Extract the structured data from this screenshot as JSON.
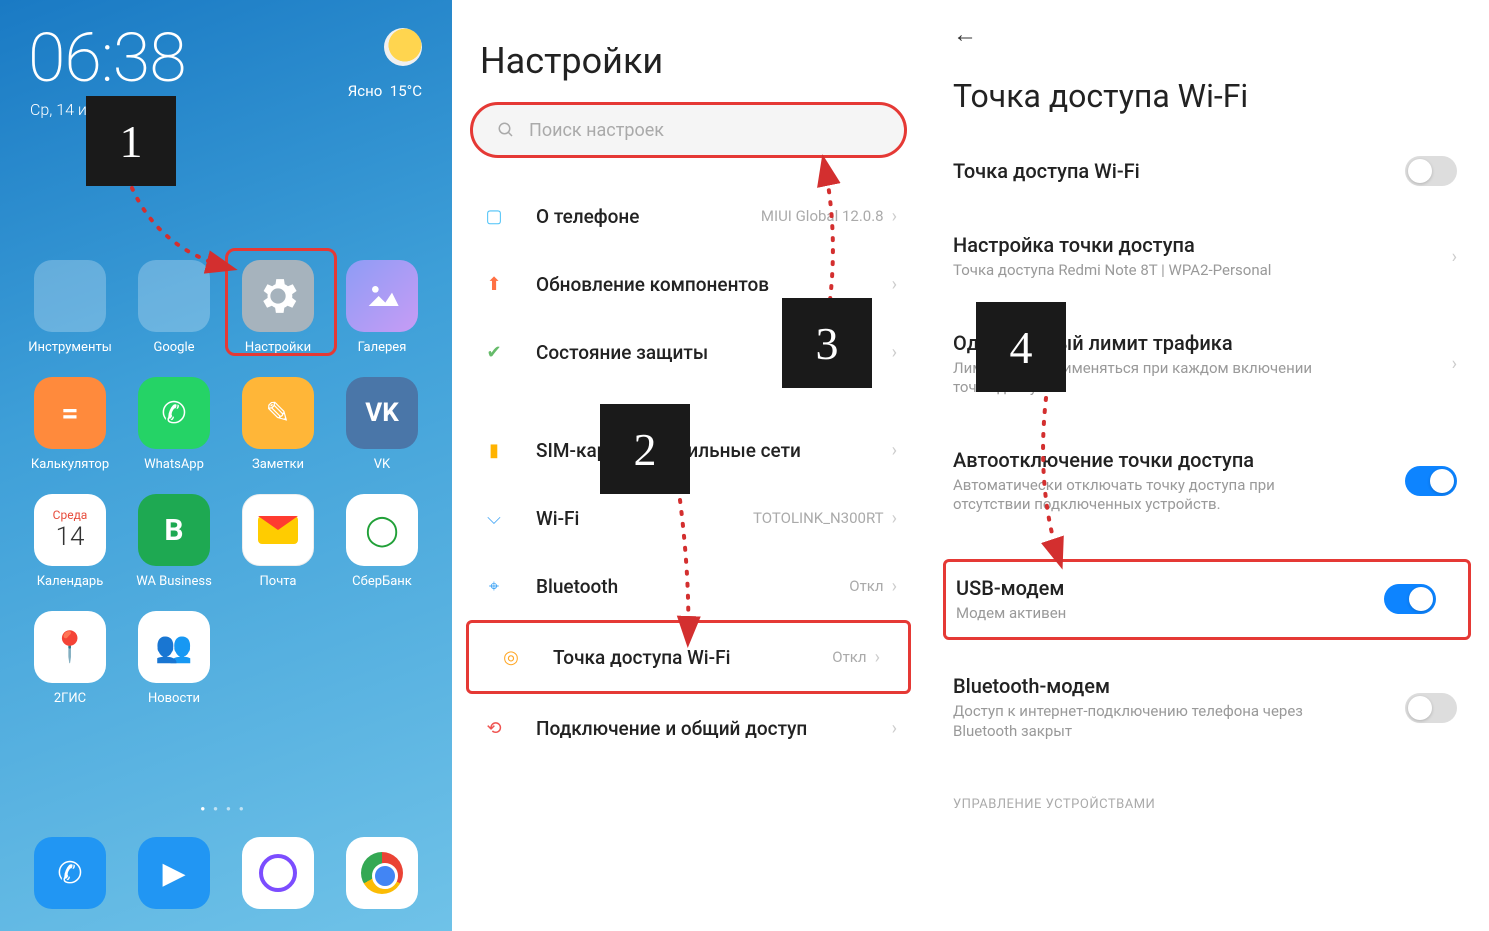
{
  "panel1": {
    "time": "06:38",
    "date": "Ср, 14 июля",
    "weather_cond": "Ясно",
    "weather_temp": "15°C",
    "apps_row1": [
      {
        "label": "Инструменты",
        "type": "folder"
      },
      {
        "label": "Google",
        "type": "folder"
      },
      {
        "label": "Настройки",
        "type": "gear"
      },
      {
        "label": "Галерея",
        "type": "gal"
      }
    ],
    "apps_row2": [
      {
        "label": "Калькулятор",
        "type": "calc",
        "glyph": "="
      },
      {
        "label": "WhatsApp",
        "type": "wa",
        "glyph": "✆"
      },
      {
        "label": "Заметки",
        "type": "notes",
        "glyph": "✎"
      },
      {
        "label": "VK",
        "type": "vk",
        "glyph": "VK"
      }
    ],
    "apps_row3": [
      {
        "label": "Календарь",
        "type": "cal",
        "d1": "Среда",
        "d2": "14"
      },
      {
        "label": "WA Business",
        "type": "wab",
        "glyph": "B"
      },
      {
        "label": "Почта",
        "type": "mail"
      },
      {
        "label": "СберБанк",
        "type": "sber",
        "glyph": "◯"
      }
    ],
    "apps_row4": [
      {
        "label": "2ГИС",
        "type": "gis",
        "glyph": "📍"
      },
      {
        "label": "Новости",
        "type": "news",
        "glyph": "👥"
      }
    ],
    "dock": [
      {
        "type": "phone",
        "glyph": "✆"
      },
      {
        "type": "msg",
        "glyph": "▶"
      },
      {
        "type": "cam"
      },
      {
        "type": "chrome"
      }
    ]
  },
  "panel2": {
    "title": "Настройки",
    "search_placeholder": "Поиск настроек",
    "rows": [
      {
        "icon": "phone-info",
        "color": "#4fc3f7",
        "label": "О телефоне",
        "value": "MIUI Global 12.0.8"
      },
      {
        "icon": "update",
        "color": "#ff7043",
        "label": "Обновление компонентов",
        "value": ""
      },
      {
        "icon": "shield",
        "color": "#66bb6a",
        "label": "Состояние защиты",
        "value": ""
      },
      {
        "gap": true
      },
      {
        "icon": "sim",
        "color": "#ffb300",
        "label": "SIM-карты и мобильные сети",
        "value": ""
      },
      {
        "icon": "wifi",
        "color": "#42a5f5",
        "label": "Wi-Fi",
        "value": "TOTOLINK_N300RT"
      },
      {
        "icon": "bt",
        "color": "#42a5f5",
        "label": "Bluetooth",
        "value": "Откл"
      },
      {
        "icon": "hotspot",
        "color": "#ffa726",
        "label": "Точка доступа Wi-Fi",
        "value": "Откл",
        "highlight": true
      },
      {
        "icon": "share",
        "color": "#ef5350",
        "label": "Подключение и общий доступ",
        "value": ""
      }
    ]
  },
  "panel3": {
    "title": "Точка доступа Wi-Fi",
    "rows": [
      {
        "label": "Точка доступа Wi-Fi",
        "sub": "",
        "ctrl": "toggle",
        "on": false
      },
      {
        "label": "Настройка точки доступа",
        "sub": "Точка доступа Redmi Note 8T | WPA2-Personal",
        "ctrl": "chev"
      },
      {
        "label": "Однократный лимит трафика",
        "sub": "Лимит будет применяться при каждом включении точки доступа.",
        "ctrl": "chev"
      },
      {
        "label": "Автоотключение точки доступа",
        "sub": "Автоматически отключать точку доступа при отсутствии подключенных устройств.",
        "ctrl": "toggle",
        "on": true
      },
      {
        "label": "USB-модем",
        "sub": "Модем активен",
        "ctrl": "toggle",
        "on": true,
        "highlight": true
      },
      {
        "label": "Bluetooth-модем",
        "sub": "Доступ к интернет-подключению телефона через Bluetooth закрыт",
        "ctrl": "toggle",
        "on": false
      }
    ],
    "section": "УПРАВЛЕНИЕ УСТРОЙСТВАМИ"
  },
  "steps": {
    "1": "1",
    "2": "2",
    "3": "3",
    "4": "4"
  }
}
